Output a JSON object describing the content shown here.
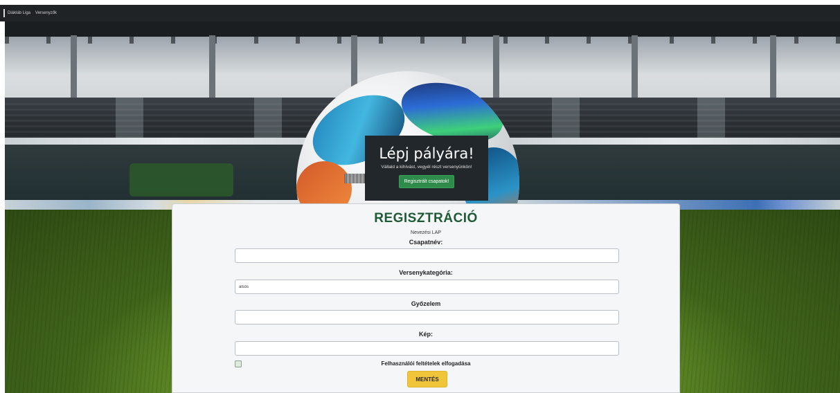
{
  "navbar": {
    "brand": "Diákláb Liga",
    "items": [
      "Versenyzők"
    ]
  },
  "hero": {
    "title": "Lépj pályára!",
    "subtitle": "Vállald a kihívást, vegyél részt versenyünkön!",
    "button_label": "Regisztrált csapatok!"
  },
  "form": {
    "title": "REGISZTRÁCIÓ",
    "subtitle": "Nevezési LAP",
    "fields": [
      {
        "label": "Csapatnév:",
        "value": ""
      },
      {
        "label": "Versenykategória:",
        "value": "alsós"
      },
      {
        "label": "Győzelem",
        "value": ""
      },
      {
        "label": "Kép:",
        "value": ""
      }
    ],
    "terms_label": "Felhasználói feltételek elfogadása",
    "terms_checked": false,
    "save_label": "MENTÉS"
  },
  "colors": {
    "navbar": "#202326",
    "hero_bg": "#22272b",
    "hero_button": "#2e8b4a",
    "form_title": "#1f5a36",
    "save_button": "#f0c53a"
  }
}
